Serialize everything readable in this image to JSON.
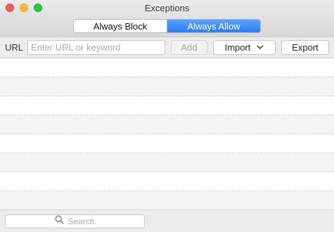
{
  "window": {
    "title": "Exceptions"
  },
  "mode_tabs": [
    {
      "label": "Always Block",
      "selected": false
    },
    {
      "label": "Always Allow",
      "selected": true
    }
  ],
  "toolbar": {
    "url_label": "URL",
    "url_placeholder": "Enter URL or keyword",
    "add_label": "Add",
    "import_label": "Import",
    "export_label": "Export"
  },
  "search": {
    "placeholder": "Search"
  },
  "colors": {
    "accent": "#2c7ef7",
    "close": "#fc5f57",
    "minimize": "#fdbc2e",
    "maximize": "#2ac840"
  },
  "icons": [
    "chevron-down-icon",
    "search-icon"
  ]
}
